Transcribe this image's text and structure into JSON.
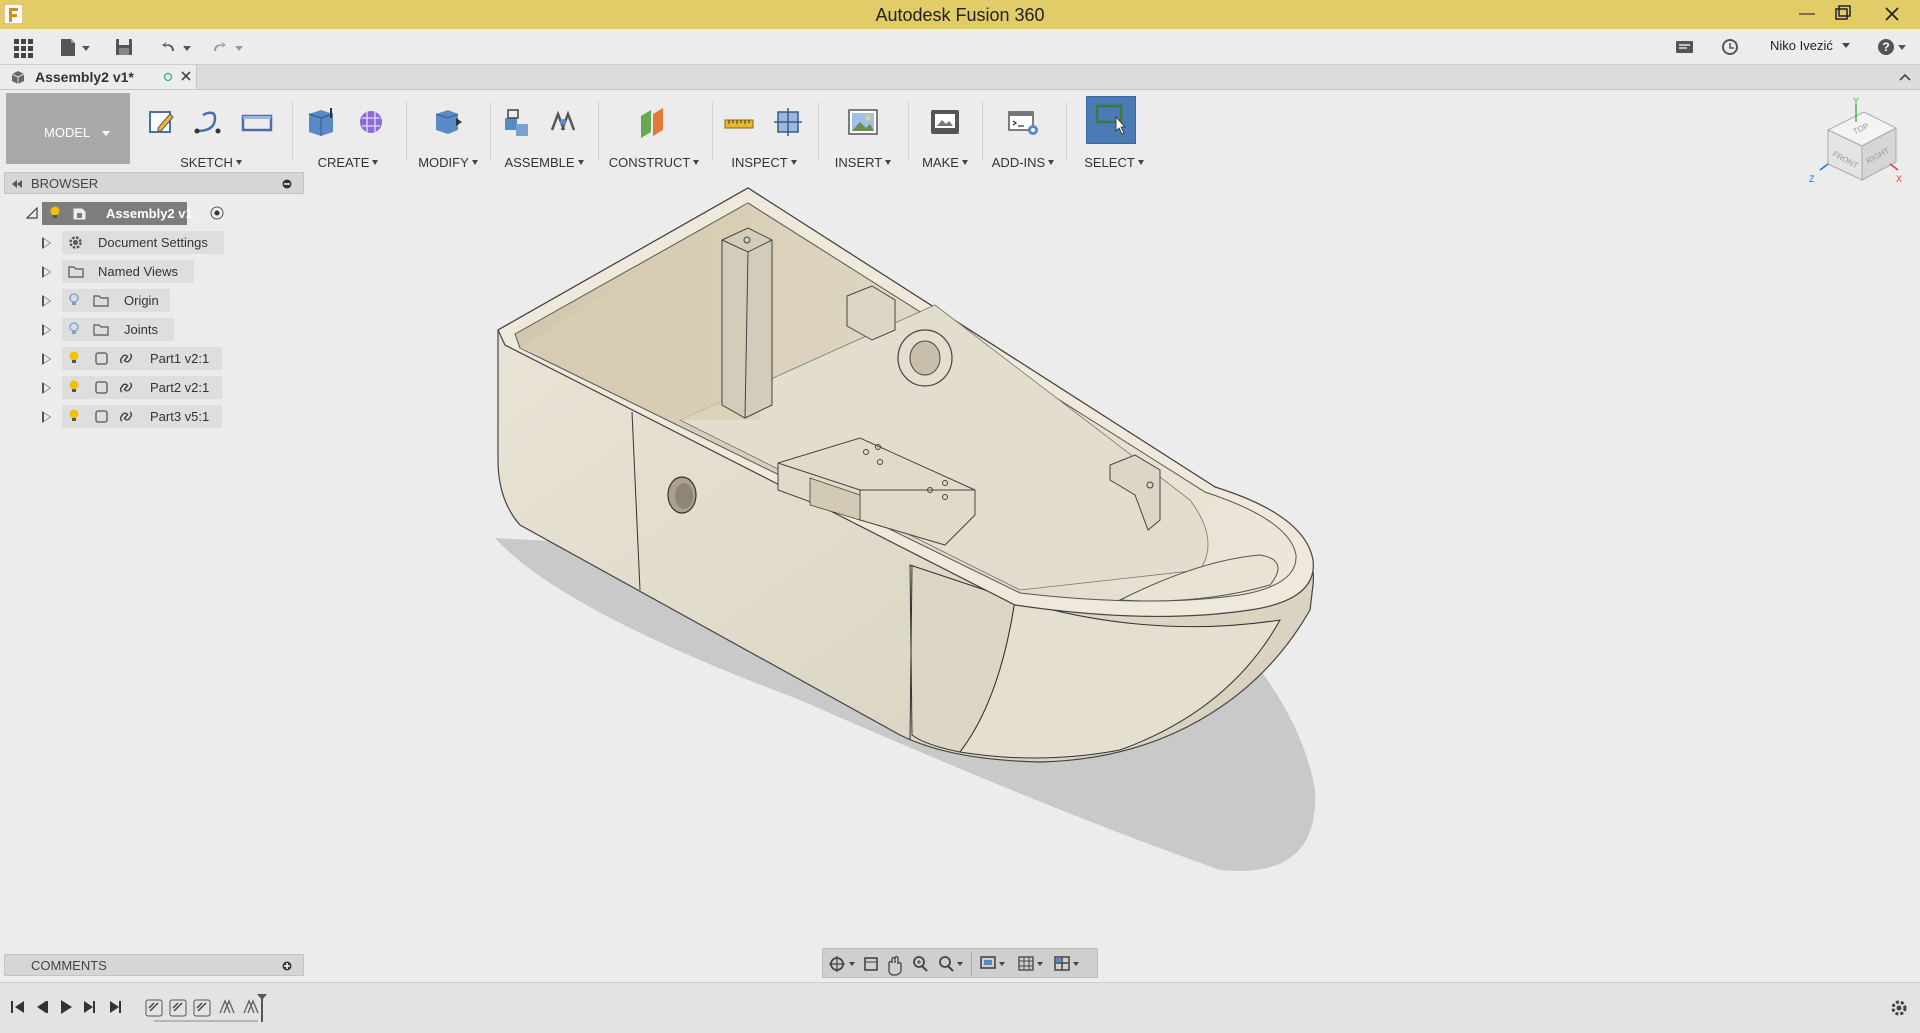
{
  "window": {
    "title": "Autodesk Fusion 360"
  },
  "qat": {
    "user": "Niko Ivezić"
  },
  "document": {
    "tab_label": "Assembly2 v1*"
  },
  "ribbon": {
    "workspace": "MODEL",
    "groups": {
      "sketch": "SKETCH",
      "create": "CREATE",
      "modify": "MODIFY",
      "assemble": "ASSEMBLE",
      "construct": "CONSTRUCT",
      "inspect": "INSPECT",
      "insert": "INSERT",
      "make": "MAKE",
      "addins": "ADD-INS",
      "select": "SELECT"
    }
  },
  "browser": {
    "header": "BROWSER",
    "root": "Assembly2 v1",
    "items": [
      {
        "label": "Document Settings",
        "icon": "gear-icon"
      },
      {
        "label": "Named Views",
        "icon": "folder-icon"
      },
      {
        "label": "Origin",
        "icon": "folder-icon",
        "visibility": "off"
      },
      {
        "label": "Joints",
        "icon": "folder-icon",
        "visibility": "off"
      },
      {
        "label": "Part1 v2:1",
        "icon": "link-icon",
        "visibility": "on"
      },
      {
        "label": "Part2 v2:1",
        "icon": "link-icon",
        "visibility": "on"
      },
      {
        "label": "Part3 v5:1",
        "icon": "link-icon",
        "visibility": "on"
      }
    ]
  },
  "comments": {
    "header": "COMMENTS"
  },
  "viewcube": {
    "top": "TOP",
    "front": "FRONT",
    "right": "RIGHT",
    "axis_x": "X",
    "axis_y": "Y",
    "axis_z": "Z"
  },
  "colors": {
    "title_bar": "#e2cc68",
    "select_active": "#4a7bb5",
    "model": "#e6e0d2",
    "visibility_on": "#f2c200"
  }
}
